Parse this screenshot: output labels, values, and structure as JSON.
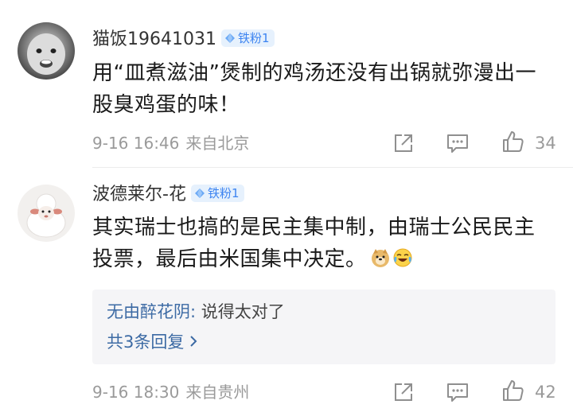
{
  "comments": [
    {
      "username": "猫饭19641031",
      "badge": "铁粉1",
      "text_lines": [
        "用“皿煮滋油”煲制的鸡汤还没有出锅就弥漫出一",
        "股臭鸡蛋的味！"
      ],
      "time": "9-16 16:46",
      "location": "来自北京",
      "likes": "34"
    },
    {
      "username": "波德莱尔-花",
      "badge": "铁粉1",
      "text_lines": [
        "其实瑞士也搞的是民主集中制，由瑞士公民民主",
        "投票，最后由米国集中决定。"
      ],
      "emojis": [
        "doge-emoji",
        "laughing-crying-emoji"
      ],
      "time": "9-16 18:30",
      "location": "来自贵州",
      "likes": "42",
      "reply_preview": {
        "user": "无由醉花阴:",
        "text": " 说得太对了",
        "more": "共3条回复"
      }
    }
  ],
  "colors": {
    "badge_bg": "#e6f1fd",
    "badge_text": "#3d84f1",
    "link": "#3c6aa4",
    "meta": "#9a9a9a"
  },
  "icons": [
    "share-icon",
    "comment-icon",
    "like-icon",
    "chevron-right-icon",
    "diamond-icon"
  ]
}
